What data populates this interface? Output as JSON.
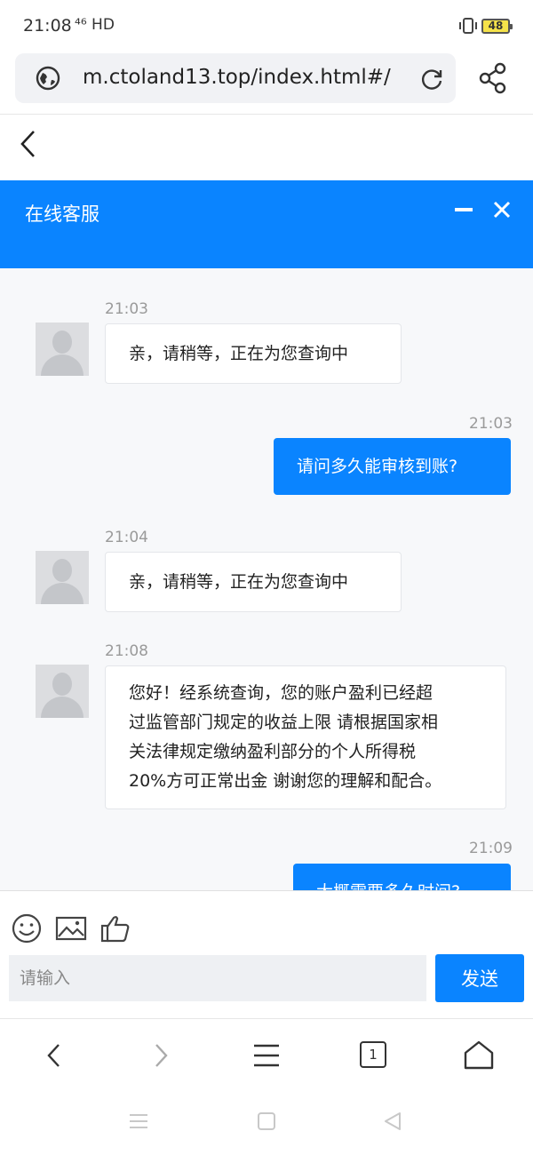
{
  "status_bar": {
    "time": "21:08",
    "signal": "⁴⁶ HD",
    "battery": "48"
  },
  "browser": {
    "url": "m.ctoland13.top/index.html#/",
    "tab_count": "1"
  },
  "chat": {
    "title": "在线客服",
    "messages": [
      {
        "from": "agent",
        "time": "21:03",
        "text": "亲，请稍等，正在为您查询中"
      },
      {
        "from": "user",
        "time": "21:03",
        "text": "请问多久能审核到账?"
      },
      {
        "from": "agent",
        "time": "21:04",
        "text": "亲，请稍等，正在为您查询中"
      },
      {
        "from": "agent",
        "time": "21:08",
        "lines": [
          "您好！经系统查询，您的账户盈利已经超",
          "过监管部门规定的收益上限 请根据国家相",
          "关法律规定缴纳盈利部分的个人所得税",
          "20%方可正常出金 谢谢您的理解和配合。"
        ]
      },
      {
        "from": "user",
        "time": "21:09",
        "text": "大概需要多久时间?"
      }
    ]
  },
  "composer": {
    "placeholder": "请输入",
    "send_label": "发送"
  },
  "colors": {
    "accent": "#0a84ff",
    "chat_bg": "#f7f8fa"
  }
}
